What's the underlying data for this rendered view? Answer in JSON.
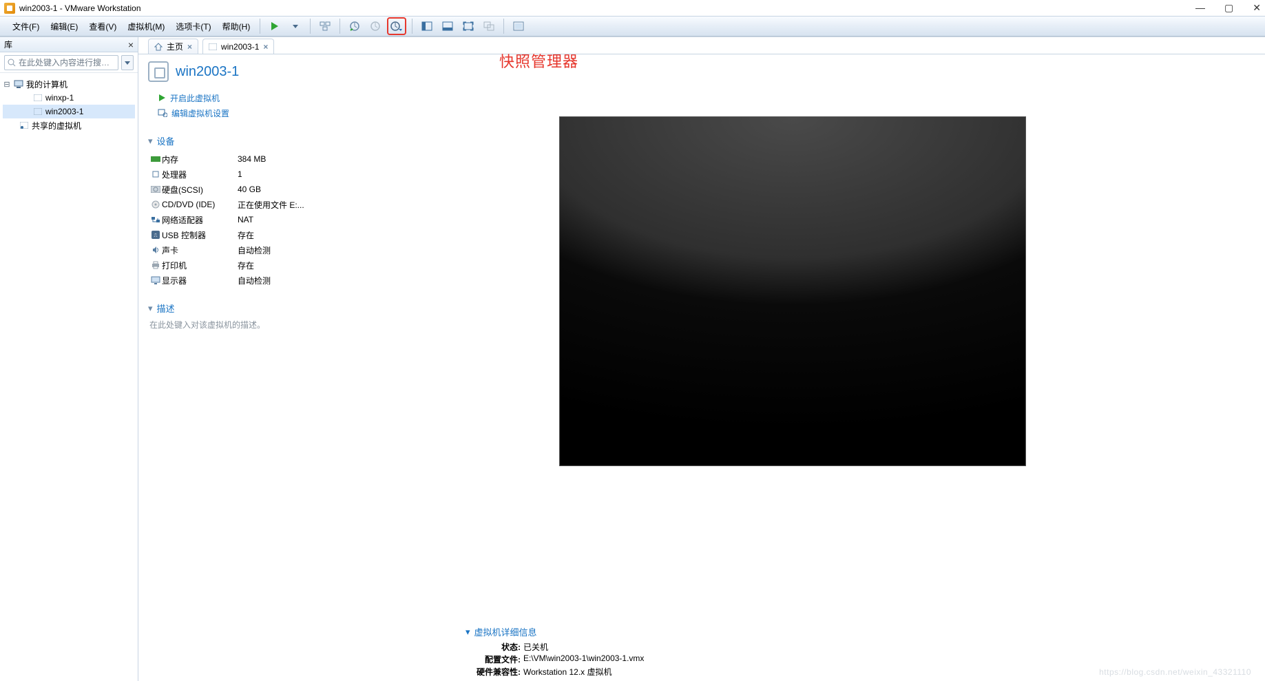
{
  "title": "win2003-1 - VMware Workstation",
  "menu": {
    "file": "文件(F)",
    "edit": "编辑(E)",
    "view": "查看(V)",
    "vm": "虚拟机(M)",
    "tabs": "选项卡(T)",
    "help": "帮助(H)"
  },
  "annotation": "快照管理器",
  "library": {
    "heading": "库",
    "search_placeholder": "在此处键入内容进行搜…",
    "nodes": {
      "my_computer": "我的计算机",
      "winxp": "winxp-1",
      "win2003": "win2003-1",
      "shared": "共享的虚拟机"
    }
  },
  "tabs_bar": {
    "home": "主页",
    "vm": "win2003-1"
  },
  "vm_name": "win2003-1",
  "actions": {
    "power_on": "开启此虚拟机",
    "edit_settings": "编辑虚拟机设置"
  },
  "sections": {
    "devices": "设备",
    "description": "描述",
    "desc_placeholder": "在此处键入对该虚拟机的描述。"
  },
  "devices": [
    {
      "label": "内存",
      "value": "384 MB"
    },
    {
      "label": "处理器",
      "value": "1"
    },
    {
      "label": "硬盘(SCSI)",
      "value": "40 GB"
    },
    {
      "label": "CD/DVD (IDE)",
      "value": "正在使用文件 E:..."
    },
    {
      "label": "网络适配器",
      "value": "NAT"
    },
    {
      "label": "USB 控制器",
      "value": "存在"
    },
    {
      "label": "声卡",
      "value": "自动检测"
    },
    {
      "label": "打印机",
      "value": "存在"
    },
    {
      "label": "显示器",
      "value": "自动检测"
    }
  ],
  "vm_info": {
    "heading": "虚拟机详细信息",
    "state_k": "状态:",
    "state_v": "已关机",
    "cfg_k": "配置文件:",
    "cfg_v": "E:\\VM\\win2003-1\\win2003-1.vmx",
    "compat_k": "硬件兼容性:",
    "compat_v": "Workstation 12.x 虚拟机"
  },
  "watermark": "https://blog.csdn.net/weixin_43321110"
}
